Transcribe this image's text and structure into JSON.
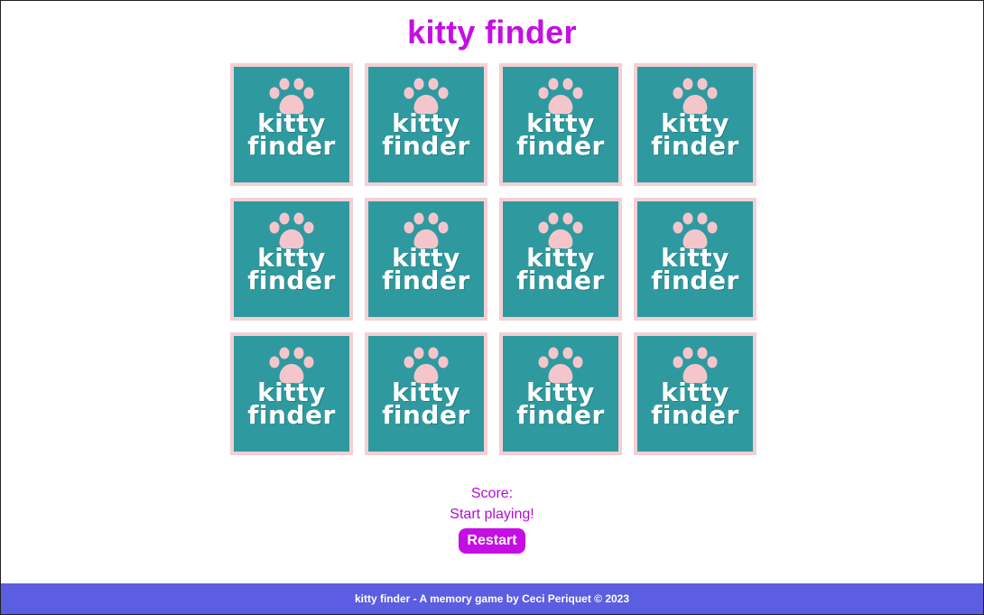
{
  "header": {
    "title": "kitty finder"
  },
  "board": {
    "card_back_line1": "kitty",
    "card_back_line2": "finder",
    "card_icon": "paw-print-icon",
    "rows": 3,
    "columns": 4,
    "cards": [
      {
        "id": 1
      },
      {
        "id": 2
      },
      {
        "id": 3
      },
      {
        "id": 4
      },
      {
        "id": 5
      },
      {
        "id": 6
      },
      {
        "id": 7
      },
      {
        "id": 8
      },
      {
        "id": 9
      },
      {
        "id": 10
      },
      {
        "id": 11
      },
      {
        "id": 12
      }
    ]
  },
  "status": {
    "score_label": "Score:",
    "message": "Start playing!",
    "restart_label": "Restart"
  },
  "footer": {
    "text": "kitty finder - A memory game by Ceci Periquet © 2023"
  },
  "colors": {
    "accent": "#c40ee3",
    "card_bg": "#2e9aa0",
    "card_border": "#f4cfd3",
    "paw": "#f4c6cb",
    "footer_bg": "#5b5ee0"
  }
}
